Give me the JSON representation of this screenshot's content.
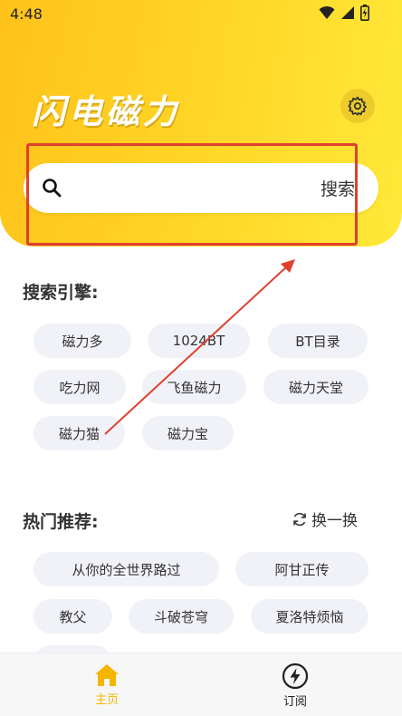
{
  "status_bar": {
    "time": "4:48"
  },
  "header": {
    "title": "闪电磁力"
  },
  "search": {
    "placeholder": "",
    "button_label": "搜索"
  },
  "engines": {
    "title": "搜索引擎:",
    "items": [
      "磁力多",
      "1024BT",
      "BT目录",
      "吃力网",
      "飞鱼磁力",
      "磁力天堂",
      "磁力猫",
      "磁力宝"
    ]
  },
  "hot": {
    "title": "热门推荐:",
    "refresh_label": "换一换",
    "items": [
      "从你的全世界路过",
      "阿甘正传",
      "教父",
      "斗破苍穹",
      "夏洛特烦恼"
    ]
  },
  "bottom_nav": {
    "items": [
      {
        "label": "主页",
        "icon": "home-icon",
        "active": true
      },
      {
        "label": "订阅",
        "icon": "lightning-icon",
        "active": false
      }
    ]
  },
  "colors": {
    "accent": "#ffc21a",
    "accent_text": "#f5b400",
    "annotation": "#e0402e"
  }
}
